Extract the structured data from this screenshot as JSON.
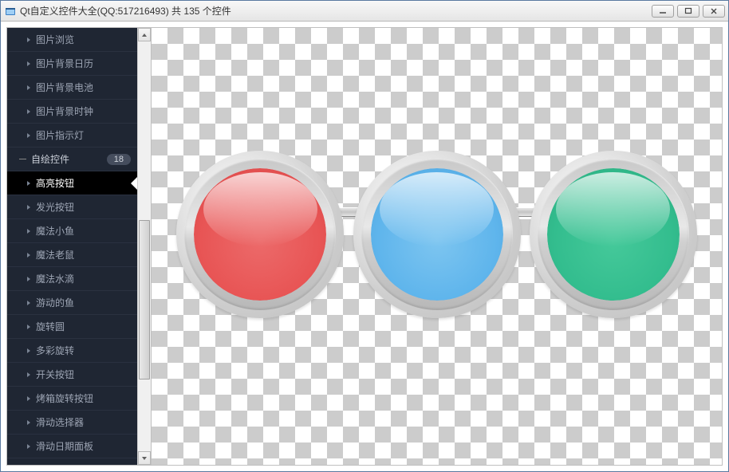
{
  "window": {
    "title": "Qt自定义控件大全(QQ:517216493) 共 135 个控件"
  },
  "sidebar": {
    "items_above": [
      "图片浏览",
      "图片背景日历",
      "图片背景电池",
      "图片背景时钟",
      "图片指示灯"
    ],
    "category": {
      "label": "自绘控件",
      "badge": "18"
    },
    "selected": "高亮按钮",
    "items_below": [
      "发光按钮",
      "魔法小鱼",
      "魔法老鼠",
      "魔法水滴",
      "游动的鱼",
      "旋转圆",
      "多彩旋转",
      "开关按钮",
      "烤箱旋转按钮",
      "滑动选择器",
      "滑动日期面板"
    ]
  },
  "preview": {
    "buttons": [
      {
        "name": "glossy-button-red",
        "color_class": "c-red",
        "color": "#e85555"
      },
      {
        "name": "glossy-button-blue",
        "color_class": "c-blue",
        "color": "#5fb5ec"
      },
      {
        "name": "glossy-button-teal",
        "color_class": "c-teal",
        "color": "#33bd8e"
      }
    ]
  }
}
